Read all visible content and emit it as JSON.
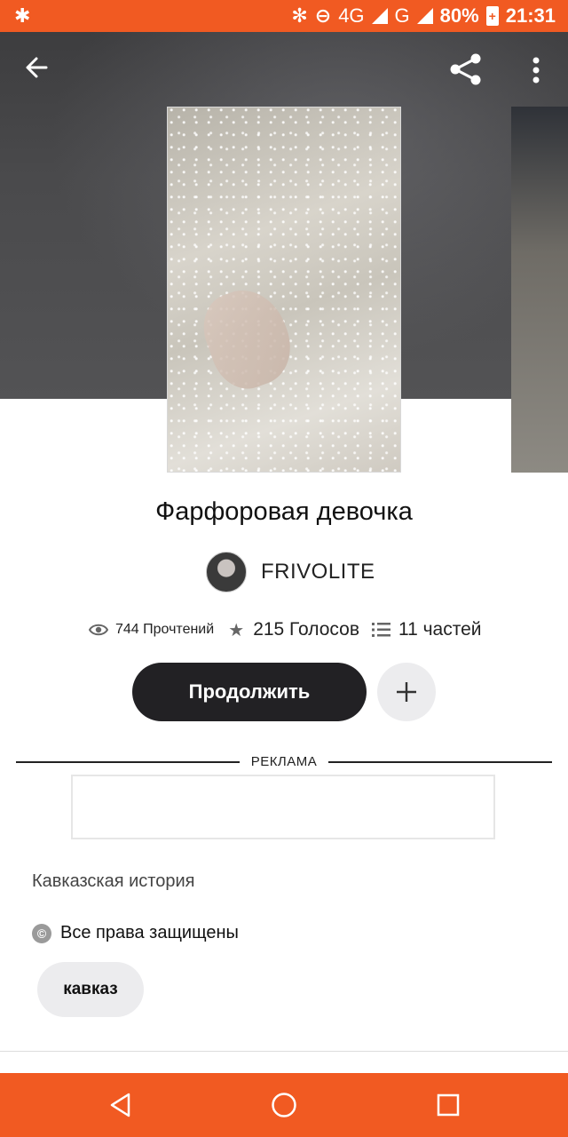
{
  "status_bar": {
    "network": "4G",
    "network_small": "4G",
    "network2": "G",
    "battery": "80%",
    "time": "21:31",
    "icons": [
      "tree-icon",
      "bluetooth-icon",
      "do-not-disturb-icon",
      "signal-icon",
      "battery-icon"
    ]
  },
  "toolbar": {
    "back_icon": "arrow-left-icon",
    "share_icon": "share-icon",
    "more_icon": "more-vertical-icon"
  },
  "story": {
    "title": "Фарфоровая девочка",
    "author": "FRIVOLITE",
    "reads": "744 Прочтений",
    "votes": "215 Голосов",
    "parts": "11 частей",
    "continue_label": "Продолжить",
    "add_label": "+",
    "description": "Кавказская история",
    "copyright": "Все права защищены",
    "copyright_icon": "©",
    "tag": "кавказ"
  },
  "ad": {
    "label": "РЕКЛАМА"
  },
  "colors": {
    "accent": "#f15a22",
    "button_dark": "#222124",
    "chip_bg": "#ececee"
  }
}
